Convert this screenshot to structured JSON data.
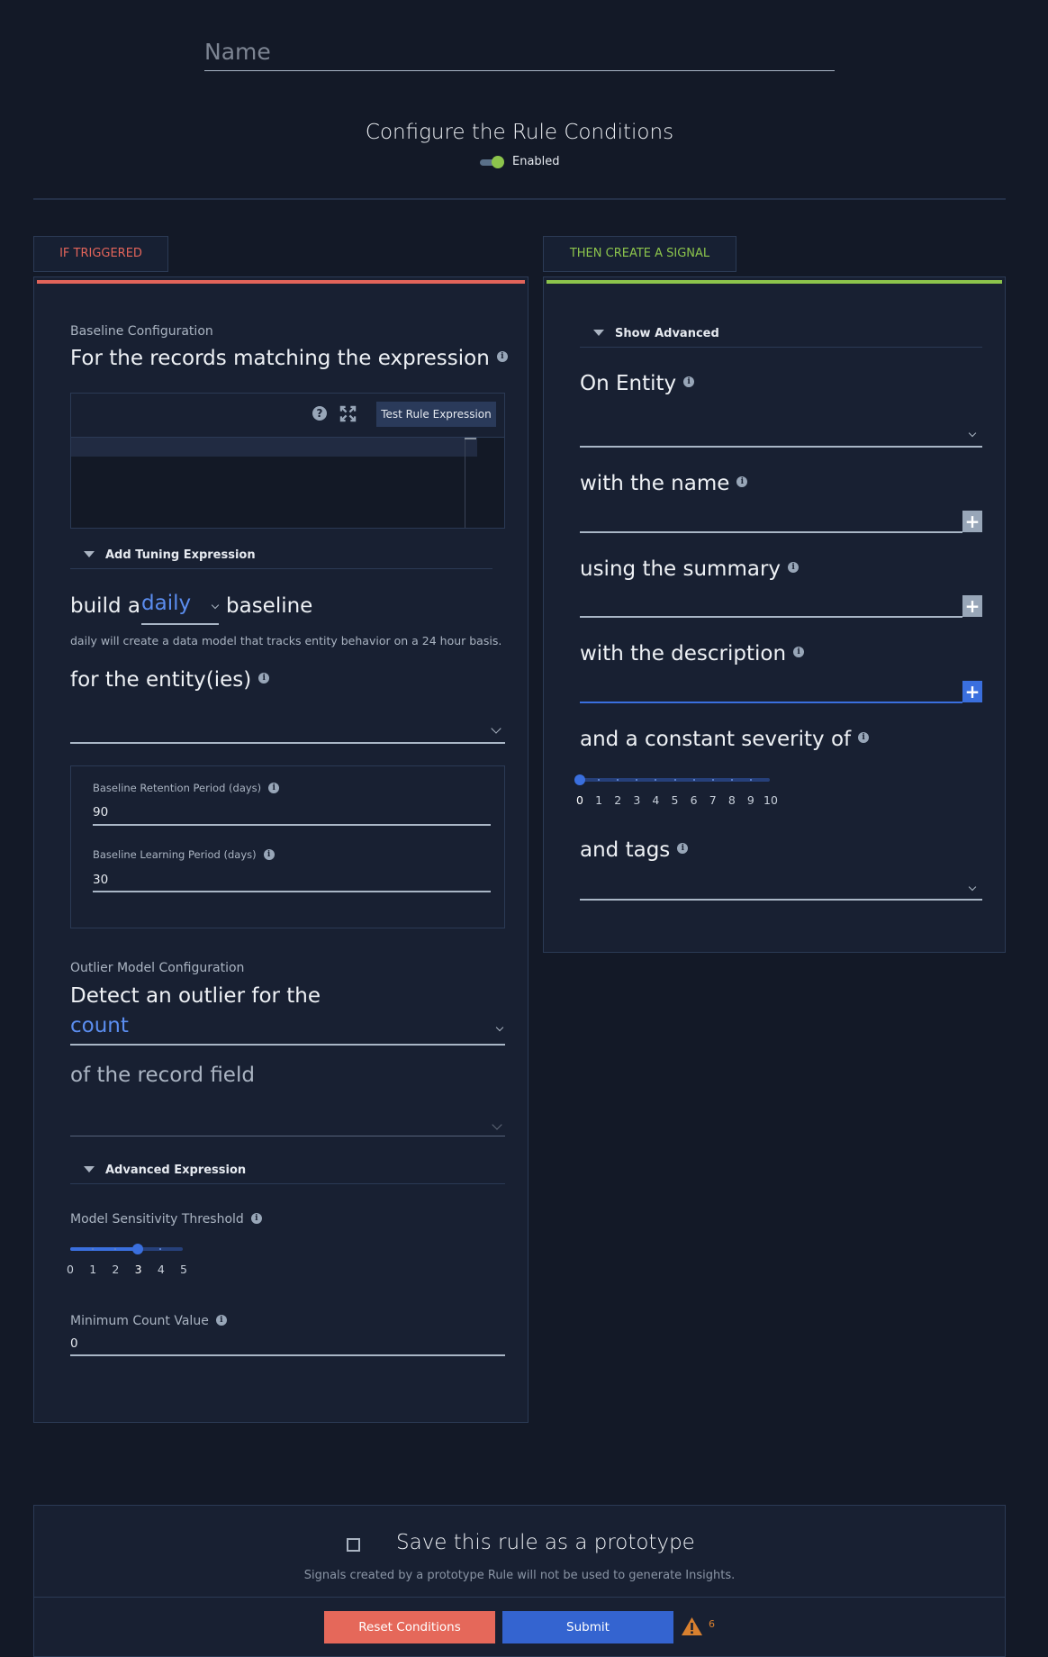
{
  "header": {
    "name_placeholder": "Name",
    "name_value": "",
    "title": "Configure the Rule Conditions",
    "toggle_label": "Enabled",
    "toggle_on": true
  },
  "tabs": {
    "left": "IF TRIGGERED",
    "right": "THEN CREATE A SIGNAL"
  },
  "colors": {
    "background": "#131927",
    "panel": "#182032",
    "trigger_accent": "#e2645a",
    "signal_accent": "#8cc44c",
    "link_blue": "#5b8def",
    "primary": "#3464d0",
    "danger": "#e5685a",
    "warning": "#d8802f"
  },
  "left_panel": {
    "baseline_section_label": "Baseline Configuration",
    "expression_heading": "For the records matching the expression",
    "editor": {
      "help_icon": "question-circle-icon",
      "expand_icon": "expand-icon",
      "test_button": "Test Rule Expression",
      "content": ""
    },
    "tuning_toggle": "Add Tuning Expression",
    "build_prefix": "build a",
    "baseline_period": "daily",
    "build_suffix": "baseline",
    "baseline_help": "daily will create a data model that tracks entity behavior on a 24 hour basis.",
    "entity_heading": "for the entity(ies)",
    "entity_value": "",
    "retention_label": "Baseline Retention Period (days)",
    "retention_value": "90",
    "learning_label": "Baseline Learning Period (days)",
    "learning_value": "30",
    "outlier_section_label": "Outlier Model Configuration",
    "outlier_heading": "Detect an outlier for the",
    "outlier_aggregation": "count",
    "record_field_heading": "of the record field",
    "record_field_value": "",
    "advanced_toggle": "Advanced Expression",
    "sensitivity_label": "Model Sensitivity Threshold",
    "sensitivity": {
      "min": 0,
      "max": 5,
      "value": 3,
      "ticks": [
        "0",
        "1",
        "2",
        "3",
        "4",
        "5"
      ]
    },
    "min_count_label": "Minimum Count Value",
    "min_count_value": "0"
  },
  "right_panel": {
    "advanced_toggle": "Show Advanced",
    "entity_heading": "On Entity",
    "entity_value": "",
    "name_heading": "with the name",
    "name_value": "",
    "summary_heading": "using the summary",
    "summary_value": "",
    "description_heading": "with the description",
    "description_value": "",
    "severity_heading": "and a constant severity of",
    "severity": {
      "min": 0,
      "max": 10,
      "value": 0,
      "ticks": [
        "0",
        "1",
        "2",
        "3",
        "4",
        "5",
        "6",
        "7",
        "8",
        "9",
        "10"
      ]
    },
    "tags_heading": "and tags",
    "tags_value": "",
    "plus_label": "+"
  },
  "footer": {
    "prototype_checked": false,
    "prototype_label": "Save this rule as a prototype",
    "prototype_help": "Signals created by a prototype Rule will not be used to generate Insights.",
    "reset_button": "Reset Conditions",
    "submit_button": "Submit",
    "warning_count": "6"
  }
}
